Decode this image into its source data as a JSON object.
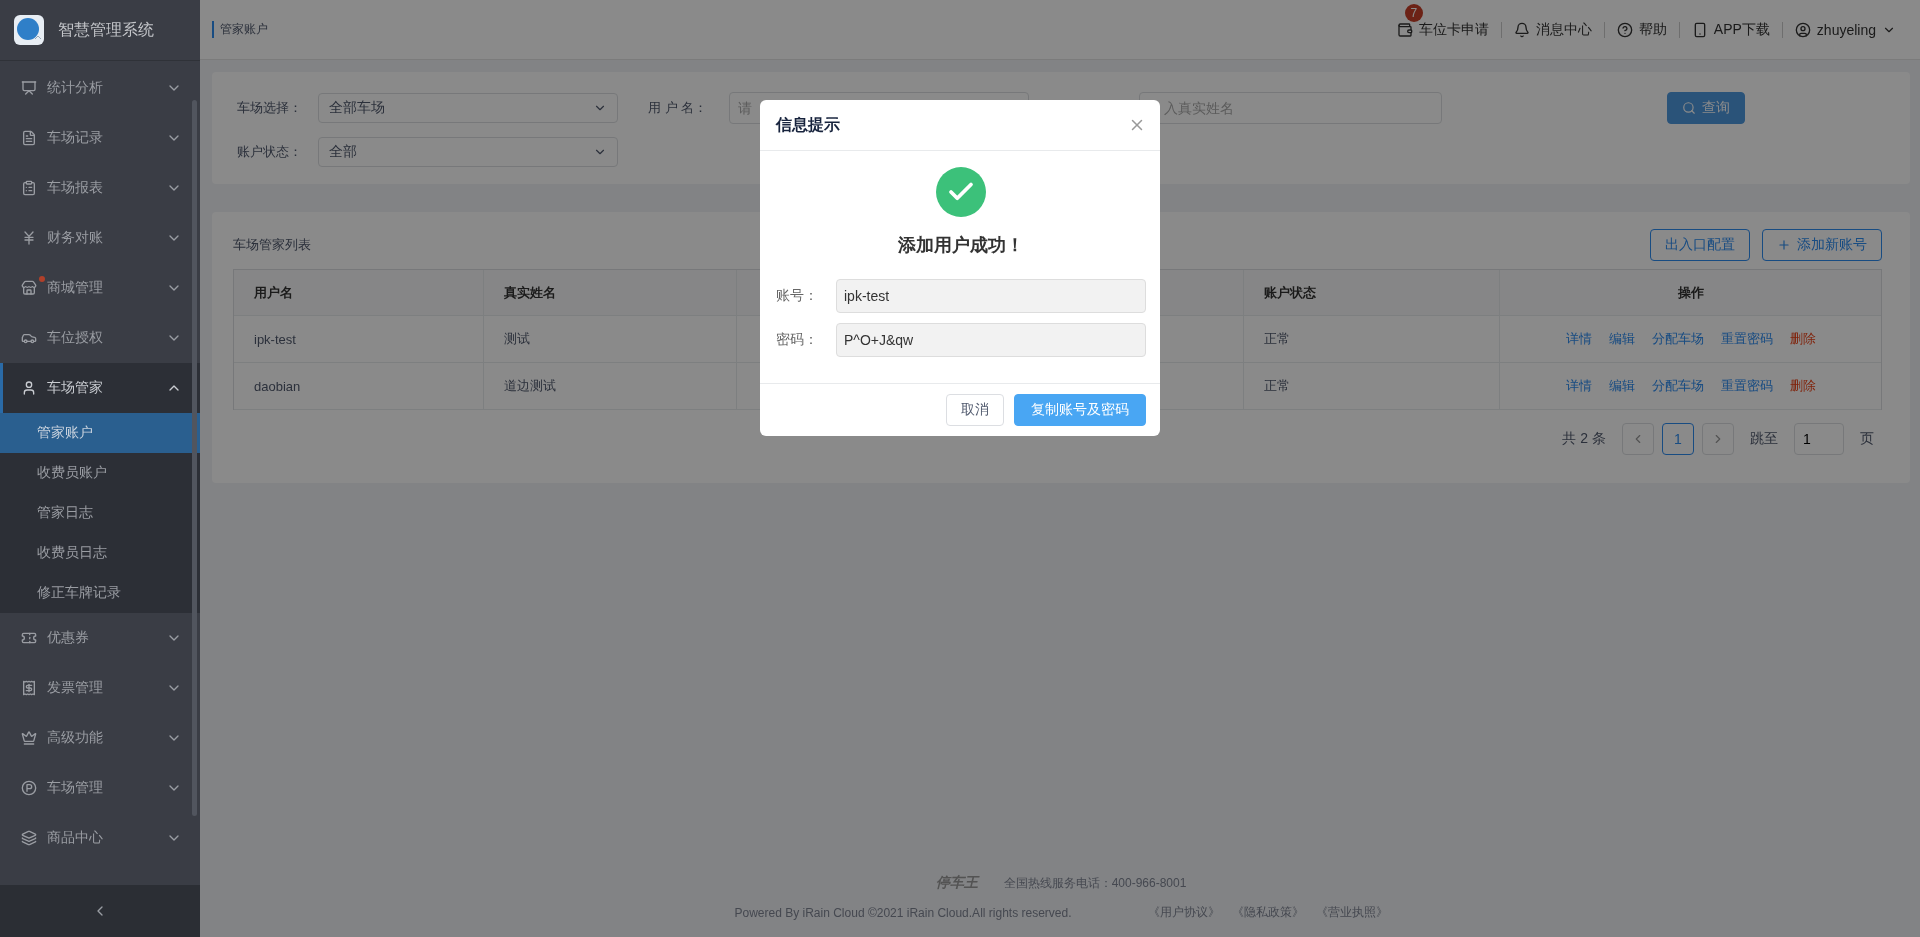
{
  "sidebar": {
    "title": "智慧管理系统",
    "items": [
      {
        "label": "统计分析",
        "expanded": false,
        "dot": false,
        "selected": false
      },
      {
        "label": "车场记录",
        "expanded": false,
        "dot": false,
        "selected": false
      },
      {
        "label": "车场报表",
        "expanded": false,
        "dot": false,
        "selected": false
      },
      {
        "label": "财务对账",
        "expanded": false,
        "dot": false,
        "selected": false
      },
      {
        "label": "商城管理",
        "expanded": false,
        "dot": true,
        "selected": false
      },
      {
        "label": "车位授权",
        "expanded": false,
        "dot": false,
        "selected": false
      },
      {
        "label": "车场管家",
        "expanded": true,
        "dot": false,
        "selected": true,
        "children": [
          {
            "label": "管家账户",
            "selected": true
          },
          {
            "label": "收费员账户",
            "selected": false
          },
          {
            "label": "管家日志",
            "selected": false
          },
          {
            "label": "收费员日志",
            "selected": false
          },
          {
            "label": "修正车牌记录",
            "selected": false
          }
        ]
      },
      {
        "label": "优惠券",
        "expanded": false,
        "dot": false,
        "selected": false
      },
      {
        "label": "发票管理",
        "expanded": false,
        "dot": false,
        "selected": false
      },
      {
        "label": "高级功能",
        "expanded": false,
        "dot": false,
        "selected": false
      },
      {
        "label": "车场管理",
        "expanded": false,
        "dot": false,
        "selected": false
      },
      {
        "label": "商品中心",
        "expanded": false,
        "dot": false,
        "selected": false
      }
    ]
  },
  "breadcrumb": "管家账户",
  "topbar": {
    "items": [
      {
        "label": "车位卡申请",
        "badge": "7"
      },
      {
        "label": "消息中心"
      },
      {
        "label": "帮助"
      },
      {
        "label": "APP下载"
      }
    ],
    "user": "zhuyeling"
  },
  "filters": {
    "park_label": "车场选择：",
    "park_value": "全部车场",
    "username_label": "用 户 名：",
    "username_placeholder": "请",
    "realname_placeholder": "入真实姓名",
    "query_button": "查询",
    "status_label": "账户状态：",
    "status_value": "全部"
  },
  "table": {
    "title": "车场管家列表",
    "buttons": [
      "出入口配置",
      "添加新账号"
    ],
    "columns": [
      "用户名",
      "真实姓名",
      "账户状态",
      "操作"
    ],
    "rows": [
      {
        "cells": [
          "ipk-test",
          "测试",
          "正常"
        ],
        "actions": [
          {
            "label": "详情",
            "kind": "link"
          },
          {
            "label": "编辑",
            "kind": "link"
          },
          {
            "label": "分配车场",
            "kind": "link"
          },
          {
            "label": "重置密码",
            "kind": "link"
          },
          {
            "label": "删除",
            "kind": "danger"
          }
        ]
      },
      {
        "cells": [
          "daobian",
          "道边测试",
          "正常"
        ],
        "actions": [
          {
            "label": "详情",
            "kind": "link"
          },
          {
            "label": "编辑",
            "kind": "link"
          },
          {
            "label": "分配车场",
            "kind": "link"
          },
          {
            "label": "重置密码",
            "kind": "link"
          },
          {
            "label": "删除",
            "kind": "danger"
          }
        ]
      }
    ]
  },
  "pagination": {
    "total": "共 2 条",
    "pages": [
      {
        "label": "1",
        "selected": true
      }
    ],
    "jump_label": "跳至",
    "jump_value": "1",
    "page_unit": "页"
  },
  "footer": {
    "logo": "停车王",
    "hotline": "全国热线服务电话：400-966-8001",
    "copyright": "Powered By iRain Cloud ©2021 iRain Cloud.All rights reserved.",
    "links": [
      "《用户协议》",
      "《隐私政策》",
      "《营业执照》"
    ]
  },
  "dialog": {
    "title": "信息提示",
    "message": "添加用户成功！",
    "fields": [
      {
        "label": "账号：",
        "value": "ipk-test"
      },
      {
        "label": "密码：",
        "value": "P^O+J&qw"
      }
    ],
    "buttons": [
      {
        "label": "取消",
        "kind": "cancel"
      },
      {
        "label": "复制账号及密码",
        "kind": "primary"
      }
    ]
  }
}
